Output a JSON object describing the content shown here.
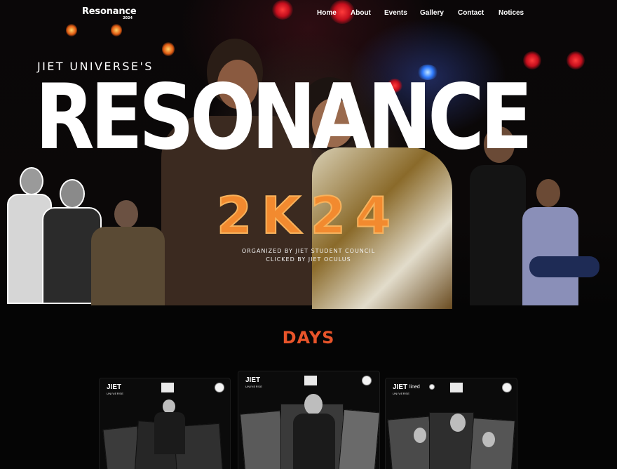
{
  "nav": {
    "logo": "Resonance",
    "logo_year": "2024",
    "items": [
      "Home",
      "About",
      "Events",
      "Gallery",
      "Contact",
      "Notices"
    ]
  },
  "hero": {
    "kicker": "JIET UNIVERSE'S",
    "title": "RESONANCE",
    "year": "2K24",
    "credit_1": "ORGANIZED BY JIET STUDENT COUNCIL",
    "credit_2": "CLICKED BY JIET OCULUS"
  },
  "days": {
    "title": "DAYS",
    "cards": [
      {
        "brand": "JIET",
        "brand_sub": "UNIVERSE"
      },
      {
        "brand": "JIET",
        "brand_sub": "UNIVERSE"
      },
      {
        "brand": "JIET",
        "brand_sub": "UNIVERSE",
        "sponsor": "lined"
      }
    ]
  },
  "colors": {
    "accent": "#e8542a",
    "year_orange": "#f28a2f",
    "background": "#050505"
  }
}
